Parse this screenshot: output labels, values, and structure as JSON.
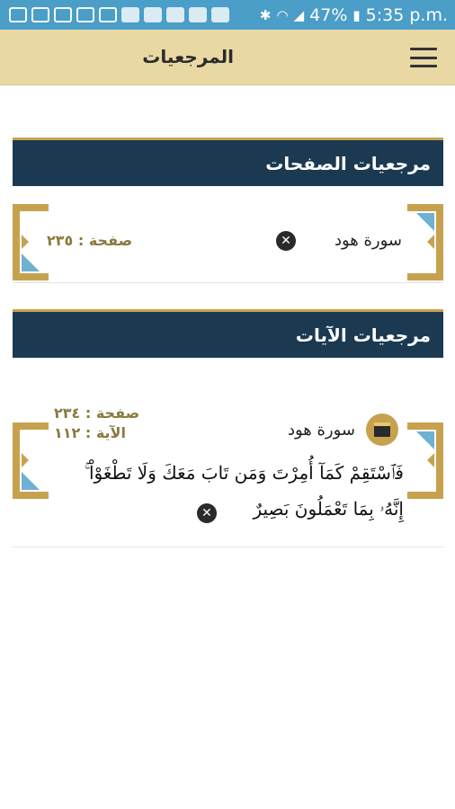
{
  "status_bar": {
    "battery": "47%",
    "time": "5:35 p.m."
  },
  "app_bar": {
    "title": "المرجعيات"
  },
  "page_bookmarks": {
    "header": "مرجعيات الصفحات",
    "items": [
      {
        "surah": "سورة هود",
        "page": "صفحة : ٢٣٥"
      }
    ]
  },
  "ayah_bookmarks": {
    "header": "مرجعيات الآيات",
    "items": [
      {
        "surah": "سورة هود",
        "page": "صفحة : ٢٣٤",
        "ayah": "الآية : ١١٢",
        "text_line1": "فَٱسْتَقِمْ كَمَآ أُمِرْتَ وَمَن تَابَ مَعَكَ وَلَا تَطْغَوْاْ ۚ",
        "text_line2": "إِنَّهُۥ بِمَا تَعْمَلُونَ بَصِيرٌ"
      }
    ]
  },
  "colors": {
    "status_bar": "#4a9ec8",
    "app_bar": "#e9d8a4",
    "section_bar": "#1b3a52",
    "gold": "#c7a24e"
  }
}
